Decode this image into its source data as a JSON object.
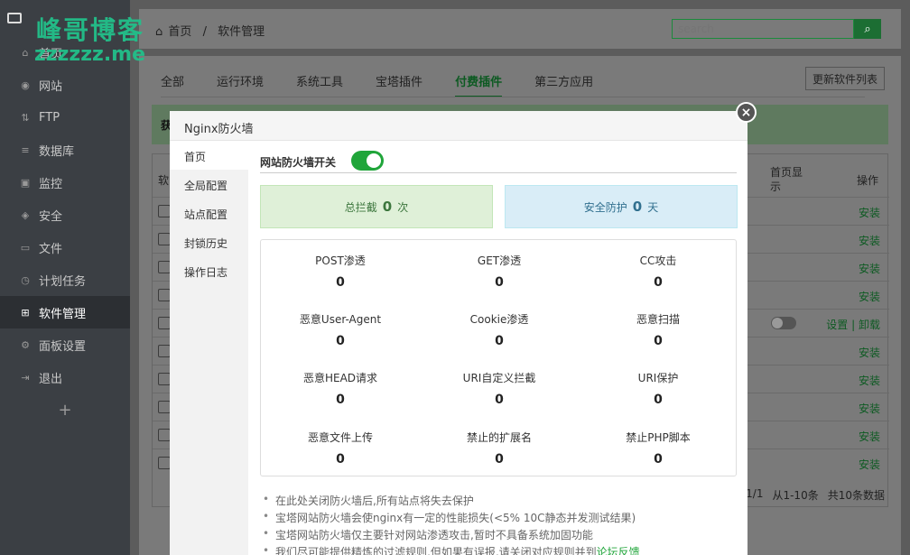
{
  "watermark": {
    "line1": "峰哥博客",
    "line2": "zzzzzz.me"
  },
  "sidebar": {
    "items": [
      {
        "label": "首页",
        "icon": "home-icon"
      },
      {
        "label": "网站",
        "icon": "globe-icon"
      },
      {
        "label": "FTP",
        "icon": "ftp-icon"
      },
      {
        "label": "数据库",
        "icon": "database-icon"
      },
      {
        "label": "监控",
        "icon": "monitor-icon"
      },
      {
        "label": "安全",
        "icon": "shield-icon"
      },
      {
        "label": "文件",
        "icon": "folder-icon"
      },
      {
        "label": "计划任务",
        "icon": "clock-icon"
      },
      {
        "label": "软件管理",
        "icon": "grid-icon",
        "active": true
      },
      {
        "label": "面板设置",
        "icon": "gear-icon"
      },
      {
        "label": "退出",
        "icon": "logout-icon"
      }
    ],
    "add": "+"
  },
  "header": {
    "breadcrumb_home": "首页",
    "breadcrumb_sep": "/",
    "breadcrumb_current": "软件管理",
    "search_placeholder": "search"
  },
  "tabs": [
    "全部",
    "运行环境",
    "系统工具",
    "宝塔插件",
    "付费插件",
    "第三方应用"
  ],
  "active_tab": "付费插件",
  "refresh_button": "更新软件列表",
  "notice_text": "获",
  "table": {
    "col_software": "软",
    "col_show": "首页显示",
    "col_ops": "操作",
    "install_label": "安装",
    "ops_settings": "设置",
    "ops_sep": "|",
    "ops_uninstall": "卸载"
  },
  "pager": {
    "page": "1/1",
    "range": "从1-10条",
    "total": "共10条数据"
  },
  "modal": {
    "title": "Nginx防火墙",
    "close": "×",
    "nav": [
      "首页",
      "全局配置",
      "站点配置",
      "封锁历史",
      "操作日志"
    ],
    "switch_label": "网站防火墙开关",
    "switch_on": true,
    "stats": [
      {
        "prefix": "总拦截",
        "value": "0",
        "suffix": "次"
      },
      {
        "prefix": "安全防护",
        "value": "0",
        "suffix": "天"
      }
    ],
    "grid": [
      {
        "label": "POST渗透",
        "value": "0"
      },
      {
        "label": "GET渗透",
        "value": "0"
      },
      {
        "label": "CC攻击",
        "value": "0"
      },
      {
        "label": "恶意User-Agent",
        "value": "0"
      },
      {
        "label": "Cookie渗透",
        "value": "0"
      },
      {
        "label": "恶意扫描",
        "value": "0"
      },
      {
        "label": "恶意HEAD请求",
        "value": "0"
      },
      {
        "label": "URI自定义拦截",
        "value": "0"
      },
      {
        "label": "URI保护",
        "value": "0"
      },
      {
        "label": "恶意文件上传",
        "value": "0"
      },
      {
        "label": "禁止的扩展名",
        "value": "0"
      },
      {
        "label": "禁止PHP脚本",
        "value": "0"
      }
    ],
    "notes": [
      "在此处关闭防火墙后,所有站点将失去保护",
      "宝塔网站防火墙会使nginx有一定的性能损失(<5% 10C静态并发测试结果)",
      "宝塔网站防火墙仅主要针对网站渗透攻击,暂时不具备系统加固功能",
      "我们尽可能提供精炼的过滤规则,但如果有误报,请关闭对应规则并到"
    ],
    "feedback_link": "论坛反馈"
  }
}
